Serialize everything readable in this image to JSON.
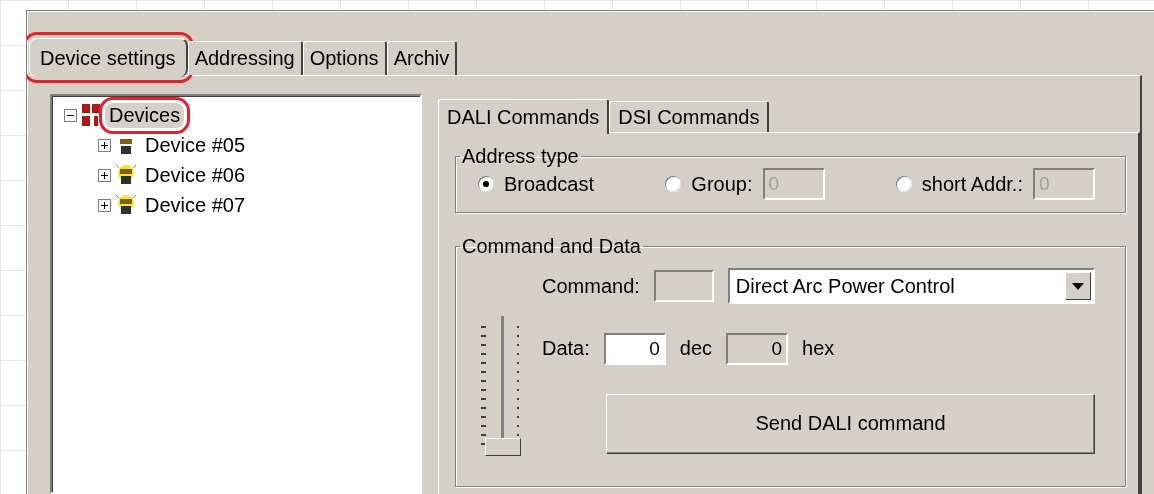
{
  "tabs": [
    {
      "label": "Device settings",
      "selected": true,
      "highlighted": true
    },
    {
      "label": "Addressing",
      "selected": false,
      "highlighted": false
    },
    {
      "label": "Options",
      "selected": false,
      "highlighted": false
    },
    {
      "label": "Archiv",
      "selected": false,
      "highlighted": false
    }
  ],
  "tree": {
    "label": "Devices",
    "kind": "root",
    "expanded": true,
    "selected": true,
    "highlighted": true,
    "children": [
      {
        "label": "Device #05",
        "kind": "device-off",
        "expanded": false,
        "selected": false,
        "highlighted": false
      },
      {
        "label": "Device #06",
        "kind": "device-on",
        "expanded": false,
        "selected": false,
        "highlighted": false
      },
      {
        "label": "Device #07",
        "kind": "device-on",
        "expanded": false,
        "selected": false,
        "highlighted": false
      }
    ]
  },
  "command_tabs": [
    {
      "label": "DALI Commands",
      "selected": true
    },
    {
      "label": "DSI Commands",
      "selected": false
    }
  ],
  "address_type": {
    "title": "Address type",
    "options": [
      {
        "label": "Broadcast",
        "selected": true
      },
      {
        "label": "Group:",
        "selected": false,
        "field": {
          "value": "0",
          "disabled": true
        }
      },
      {
        "label": "short Addr.:",
        "selected": false,
        "field": {
          "value": "0",
          "disabled": true
        }
      }
    ]
  },
  "command_and_data": {
    "title": "Command and Data",
    "command": {
      "label": "Command:",
      "code_field": {
        "disabled": true
      },
      "dropdown": {
        "value": "Direct Arc Power Control"
      }
    },
    "slider": {
      "level": 0
    },
    "data": {
      "label": "Data:",
      "dec_field": {
        "value": "0",
        "disabled": false
      },
      "dec_unit": "dec",
      "hex_field": {
        "value": "0",
        "disabled": true
      },
      "hex_unit": "hex"
    },
    "send_button": "Send DALI command"
  }
}
